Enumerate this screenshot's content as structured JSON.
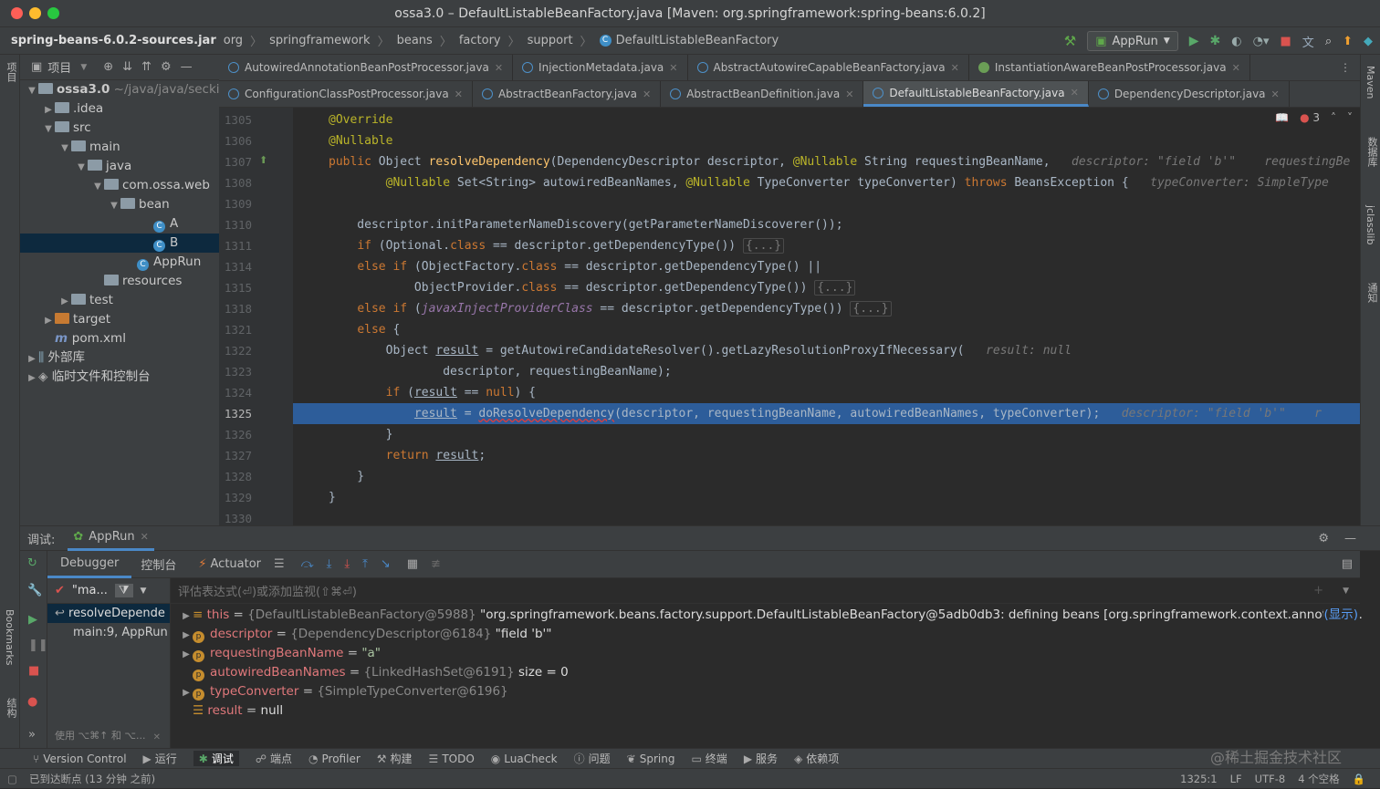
{
  "window": {
    "title": "ossa3.0 – DefaultListableBeanFactory.java [Maven: org.springframework:spring-beans:6.0.2]"
  },
  "nav": {
    "crumbs": [
      "spring-beans-6.0.2-sources.jar",
      "org",
      "springframework",
      "beans",
      "factory",
      "support",
      "DefaultListableBeanFactory"
    ],
    "run_config": "AppRun"
  },
  "left_strip": {
    "project": "项目",
    "bookmarks": "Bookmarks",
    "structure": "结构"
  },
  "right_strip": {
    "maven": "Maven",
    "database": "数据库",
    "jclasslib": "jclasslib",
    "notifications": "通知"
  },
  "project": {
    "toolbar_label": "项目",
    "tree": [
      {
        "label": "ossa3.0",
        "extra": " ~/java/java/seckill",
        "indent": 0,
        "arrow": "▼",
        "icon": "folder"
      },
      {
        "label": ".idea",
        "indent": 1,
        "arrow": "▶",
        "icon": "folder"
      },
      {
        "label": "src",
        "indent": 1,
        "arrow": "▼",
        "icon": "folder"
      },
      {
        "label": "main",
        "indent": 2,
        "arrow": "▼",
        "icon": "folder"
      },
      {
        "label": "java",
        "indent": 3,
        "arrow": "▼",
        "icon": "folder"
      },
      {
        "label": "com.ossa.web",
        "indent": 4,
        "arrow": "▼",
        "icon": "folder"
      },
      {
        "label": "bean",
        "indent": 5,
        "arrow": "▼",
        "icon": "folder"
      },
      {
        "label": "A",
        "indent": 7,
        "arrow": "",
        "icon": "class"
      },
      {
        "label": "B",
        "indent": 7,
        "arrow": "",
        "icon": "class",
        "selected": true
      },
      {
        "label": "AppRun",
        "indent": 6,
        "arrow": "",
        "icon": "class"
      },
      {
        "label": "resources",
        "indent": 4,
        "arrow": "",
        "icon": "folder"
      },
      {
        "label": "test",
        "indent": 2,
        "arrow": "▶",
        "icon": "folder"
      },
      {
        "label": "target",
        "indent": 1,
        "arrow": "▶",
        "icon": "folder-orange"
      },
      {
        "label": "pom.xml",
        "indent": 1,
        "arrow": "",
        "icon": "maven"
      },
      {
        "label": "外部库",
        "indent": 0,
        "arrow": "▶",
        "icon": "lib"
      },
      {
        "label": "临时文件和控制台",
        "indent": 0,
        "arrow": "▶",
        "icon": "scratch"
      }
    ]
  },
  "tabs_row1": [
    {
      "label": "AutowiredAnnotationBeanPostProcessor.java"
    },
    {
      "label": "InjectionMetadata.java"
    },
    {
      "label": "AbstractAutowireCapableBeanFactory.java"
    },
    {
      "label": "InstantiationAwareBeanPostProcessor.java",
      "iface": true
    }
  ],
  "tabs_row2": [
    {
      "label": "ConfigurationClassPostProcessor.java"
    },
    {
      "label": "AbstractBeanFactory.java"
    },
    {
      "label": "AbstractBeanDefinition.java"
    },
    {
      "label": "DefaultListableBeanFactory.java",
      "active": true
    },
    {
      "label": "DependencyDescriptor.java"
    }
  ],
  "editor": {
    "error_count": "3",
    "lines": [
      {
        "n": "1305",
        "html": "<span class='ann'>@Override</span>"
      },
      {
        "n": "1306",
        "html": "<span class='ann'>@Nullable</span>"
      },
      {
        "n": "1307",
        "html": "<span class='kw'>public</span> Object <span class='fn'>resolveDependency</span>(DependencyDescriptor descriptor, <span class='ann'>@Nullable</span> String requestingBeanName,   <span class='hint'>descriptor: \"field 'b'\"    requestingBe</span>"
      },
      {
        "n": "1308",
        "html": "        <span class='ann'>@Nullable</span> Set&lt;String&gt; autowiredBeanNames, <span class='ann'>@Nullable</span> TypeConverter typeConverter) <span class='kw'>throws</span> BeansException {   <span class='hint'>typeConverter: SimpleType</span>"
      },
      {
        "n": "1309",
        "html": ""
      },
      {
        "n": "1310",
        "html": "    descriptor.initParameterNameDiscovery(getParameterNameDiscoverer());"
      },
      {
        "n": "1311",
        "html": "    <span class='kw'>if</span> (Optional.<span class='kw'>class</span> == descriptor.getDependencyType()) <span class='fbox'>{...}</span>"
      },
      {
        "n": "1314",
        "html": "    <span class='kw'>else if</span> (ObjectFactory.<span class='kw'>class</span> == descriptor.getDependencyType() ||"
      },
      {
        "n": "1315",
        "html": "            ObjectProvider.<span class='kw'>class</span> == descriptor.getDependencyType()) <span class='fbox'>{...}</span>"
      },
      {
        "n": "1318",
        "html": "    <span class='kw'>else if</span> (<span class='itl'>javaxInjectProviderClass</span> == descriptor.getDependencyType()) <span class='fbox'>{...}</span>"
      },
      {
        "n": "1321",
        "html": "    <span class='kw'>else</span> {"
      },
      {
        "n": "1322",
        "html": "        Object <u>result</u> = getAutowireCandidateResolver().getLazyResolutionProxyIfNecessary(   <span class='hint'>result: null</span>"
      },
      {
        "n": "1323",
        "html": "                descriptor, requestingBeanName);"
      },
      {
        "n": "1324",
        "html": "        <span class='kw'>if</span> (<u>result</u> == <span class='kw'>null</span>) {"
      },
      {
        "n": "1325",
        "html": "            <u>result</u> = <span style='text-decoration:underline wavy #e03c3c'>doResolveDependency</span>(descriptor, requestingBeanName, autowiredBeanNames, typeConverter);   <span class='hint'>descriptor: \"field 'b'\"    r</span>",
        "highlight": true
      },
      {
        "n": "1326",
        "html": "        }"
      },
      {
        "n": "1327",
        "html": "        <span class='kw'>return</span> <u>result</u>;"
      },
      {
        "n": "1328",
        "html": "    }"
      },
      {
        "n": "1329",
        "html": "}"
      },
      {
        "n": "1330",
        "html": ""
      }
    ]
  },
  "debug": {
    "label": "调试:",
    "session": "AppRun",
    "tab_debugger": "Debugger",
    "tab_console": "控制台",
    "tab_actuator": "Actuator",
    "thread": "\"ma...",
    "eval_placeholder": "评估表达式(⏎)或添加监视(⇧⌘⏎)",
    "frames": [
      {
        "label": "resolveDepende",
        "selected": true
      },
      {
        "label": "main:9, AppRun"
      }
    ],
    "frame_hint": "使用 ⌥⌘↑ 和 ⌥...",
    "variables": [
      {
        "arrow": "▶",
        "badge": "eq",
        "name": "this",
        "eq": " = ",
        "type": "{DefaultListableBeanFactory@5988}",
        "value": " \"org.springframework.beans.factory.support.DefaultListableBeanFactory@5adb0db3: defining beans [org.springframework.context.annotatio…",
        "link": "(显示)"
      },
      {
        "arrow": "▶",
        "badge": "p",
        "name": "descriptor",
        "eq": " = ",
        "type": "{DependencyDescriptor@6184}",
        "value": " \"field 'b'\""
      },
      {
        "arrow": "▶",
        "badge": "p",
        "name": "requestingBeanName",
        "eq": " = ",
        "type": "",
        "value": "\"a\"",
        "strval": true
      },
      {
        "arrow": "",
        "badge": "p",
        "name": "autowiredBeanNames",
        "eq": " = ",
        "type": "{LinkedHashSet@6191}",
        "value": "  size = 0"
      },
      {
        "arrow": "▶",
        "badge": "p",
        "name": "typeConverter",
        "eq": " = ",
        "type": "{SimpleTypeConverter@6196}",
        "value": ""
      },
      {
        "arrow": "",
        "badge": "list",
        "name": "result",
        "eq": " = ",
        "type": "",
        "value": "null",
        "plain": true
      }
    ]
  },
  "bottom_tools": [
    "Version Control",
    "运行",
    "调试",
    "端点",
    "Profiler",
    "构建",
    "TODO",
    "LuaCheck",
    "问题",
    "Spring",
    "终端",
    "服务",
    "依赖项"
  ],
  "status": {
    "left": "已到达断点 (13 分钟 之前)",
    "position": "1325:1",
    "line_sep": "LF",
    "encoding": "UTF-8",
    "indent": "4 个空格",
    "watermark": "@稀土掘金技术社区"
  },
  "colors": {
    "accent": "#4a88c7",
    "highlight": "#2d5d9a",
    "keyword": "#cc7832",
    "annotation": "#bbb529"
  }
}
